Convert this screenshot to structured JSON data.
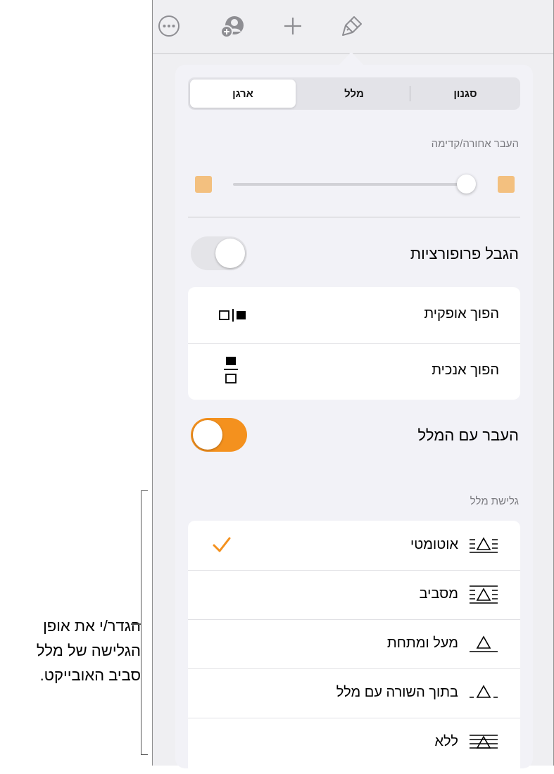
{
  "tabs": [
    {
      "label": "ארגן",
      "active": true
    },
    {
      "label": "מלל",
      "active": false
    },
    {
      "label": "סגנון",
      "active": false
    }
  ],
  "layer": {
    "section_label": "העבר אחורה/קדימה",
    "slider_value": 0.92
  },
  "constrain": {
    "label": "הגבל פרופורציות",
    "on": false
  },
  "flip": [
    {
      "label": "הפוך אופקית",
      "icon": "flip-horizontal-icon"
    },
    {
      "label": "הפוך אנכית",
      "icon": "flip-vertical-icon"
    }
  ],
  "move_with_text": {
    "label": "העבר עם המלל",
    "on": true
  },
  "wrap": {
    "section_label": "גלישת מלל",
    "options": [
      {
        "label": "אוטומטי",
        "selected": true
      },
      {
        "label": "מסביב",
        "selected": false
      },
      {
        "label": "מעל ומתחת",
        "selected": false
      },
      {
        "label": "בתוך השורה עם מלל",
        "selected": false
      },
      {
        "label": "ללא",
        "selected": false
      }
    ]
  },
  "callout": {
    "text": "הגדר/י את אופן הגלישה של מלל סביב האובייקט."
  },
  "colors": {
    "accent": "#f4911e",
    "swatch": "#f3c07f",
    "icon_gray": "#8e8e93"
  }
}
